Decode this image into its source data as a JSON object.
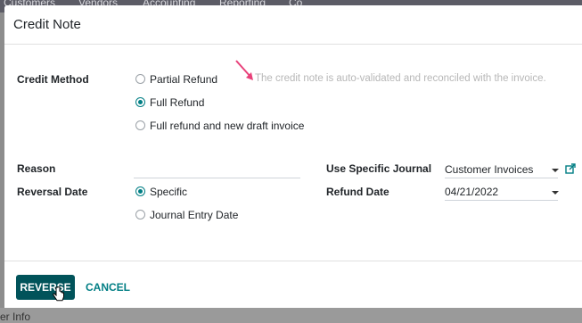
{
  "background": {
    "menu_items": [
      "Customers",
      "Vendors",
      "Accounting",
      "Reporting",
      "Co"
    ],
    "partial_text": "er Info"
  },
  "dialog": {
    "title": "Credit Note",
    "credit_method": {
      "label": "Credit Method",
      "options": [
        "Partial Refund",
        "Full Refund",
        "Full refund and new draft invoice"
      ],
      "selected": "Full Refund",
      "hint": "The credit note is auto-validated and reconciled with the invoice."
    },
    "reason": {
      "label": "Reason",
      "value": ""
    },
    "reversal_date": {
      "label": "Reversal Date",
      "options": [
        "Specific",
        "Journal Entry Date"
      ],
      "selected": "Specific"
    },
    "journal": {
      "label": "Use Specific Journal",
      "value": "Customer Invoices",
      "external_link_icon": "external-link-icon"
    },
    "refund_date": {
      "label": "Refund Date",
      "value": "04/21/2022"
    },
    "buttons": {
      "reverse": "REVERSE",
      "cancel": "CANCEL"
    }
  },
  "colors": {
    "primary": "#01535a",
    "accent": "#017e84",
    "arrow": "#e8417a"
  }
}
